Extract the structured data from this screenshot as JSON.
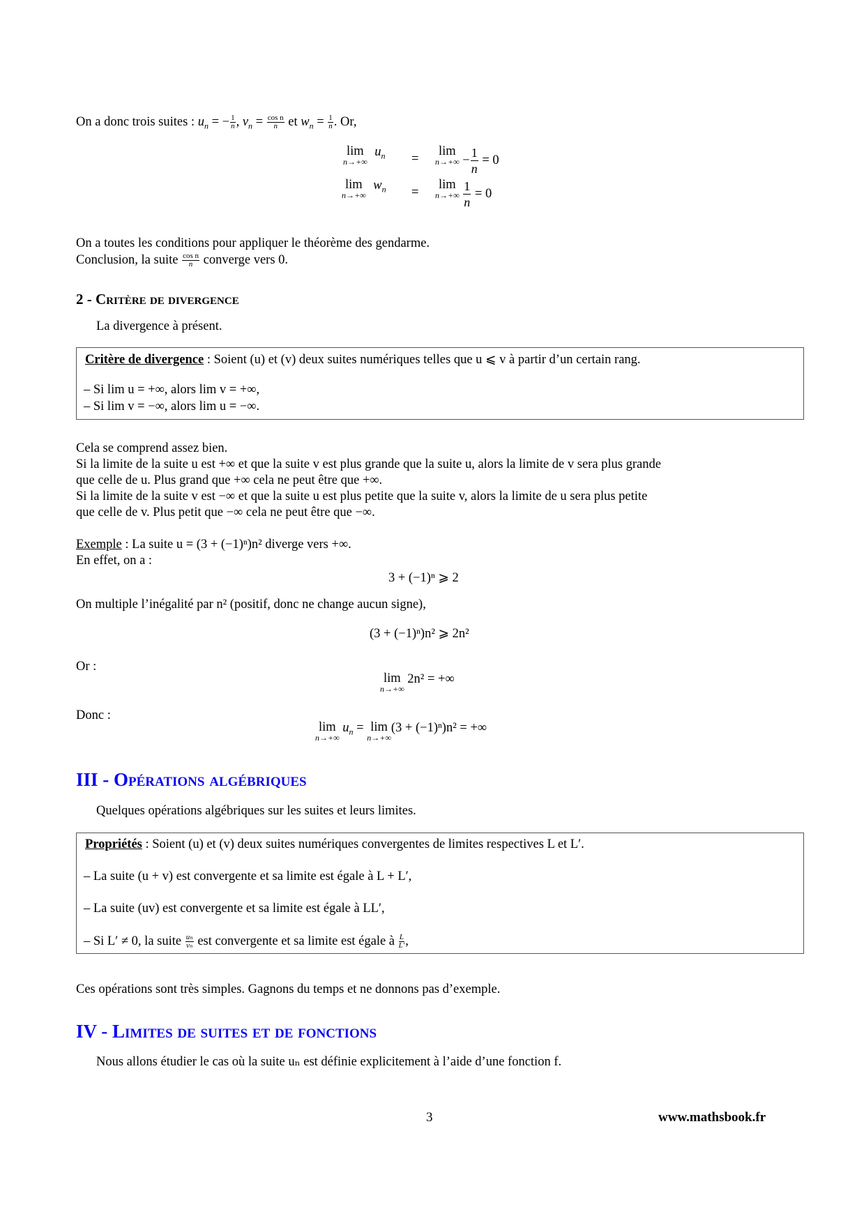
{
  "intro": {
    "line1_prefix": "On a donc trois suites : ",
    "u_def": "u",
    "u_value_text": "= −",
    "v_label": "v",
    "w_label": "w",
    "frac_1": "1",
    "frac_n": "n",
    "frac_cos": "cos n",
    "et": "et",
    "or": ". Or,"
  },
  "limits_block": {
    "row1": {
      "lhs": "lim",
      "under": "n→+∞",
      "var": "u",
      "eq": "=",
      "rhs_prefix": "−",
      "num": "1",
      "den": "n",
      "result": "= 0"
    },
    "row2": {
      "lhs": "lim",
      "under": "n→+∞",
      "var": "w",
      "eq": "=",
      "rhs_prefix": "",
      "num": "1",
      "den": "n",
      "result": "= 0"
    }
  },
  "conclusion": {
    "line1": "On a toutes les conditions pour appliquer le théorème des gendarme.",
    "line2_prefix": "Conclusion, la suite ",
    "line2_suffix": " converge vers 0."
  },
  "section2": {
    "number": "2 - ",
    "title": "Critère de divergence",
    "intro": "La divergence à présent."
  },
  "divergence_box": {
    "label": "Critère de divergence",
    "statement": " : Soient (u) et (v) deux suites numériques telles que u ⩽ v à partir d’un certain rang.",
    "item1": "– Si lim u = +∞, alors lim v = +∞,",
    "item2": "– Si lim v = −∞, alors lim u = −∞."
  },
  "explanation": {
    "l1": "Cela se comprend assez bien.",
    "l2": "Si la limite de la suite u est +∞ et que la suite v est plus grande que la suite u, alors la limite de v sera plus grande",
    "l3": "que celle de u. Plus grand que +∞ cela ne peut être que +∞.",
    "l4": "Si la limite de la suite v est −∞ et que la suite u est plus petite que la suite v, alors la limite de u sera plus petite",
    "l5": "que celle de v. Plus petit que −∞ cela ne peut être que −∞."
  },
  "example": {
    "label": "Exemple",
    "text": " : La suite u = (3 + (−1)ⁿ)n² diverge vers +∞.",
    "en_effet": "En effet, on a :",
    "ineq1": "3 + (−1)ⁿ ⩾ 2",
    "multiply": "On multiple l’inégalité par n² (positif, donc ne change aucun signe),",
    "ineq2": "(3 + (−1)ⁿ)n² ⩾ 2n²",
    "or": "Or :",
    "lim1_expr": "2n² = +∞",
    "donc": "Donc :",
    "lim2_a": "u",
    "lim2_b": "= ",
    "lim2_c": "(3 + (−1)ⁿ)n² = +∞",
    "lim_word": "lim",
    "lim_under": "n→+∞"
  },
  "section3": {
    "number": "III - ",
    "title": "Opérations algébriques",
    "intro": "Quelques opérations algébriques sur les suites et leurs limites."
  },
  "properties_box": {
    "label": "Propriétés",
    "statement": " : Soient (u) et (v) deux suites numériques convergentes de limites respectives L et L′.",
    "item1": "– La suite (u + v) est convergente et sa limite est égale à L + L′,",
    "item2": "– La suite (uv) est convergente et sa limite est égale à LL′,",
    "item3_a": "– Si L′ ≠ 0, la suite ",
    "item3_b": " est convergente et sa limite est égale à ",
    "item3_c": ",",
    "frac_un": "uₙ",
    "frac_vn": "vₙ",
    "frac_L": "L",
    "frac_Lp": "L′"
  },
  "after_props": "Ces opérations sont très simples. Gagnons du temps et ne donnons pas d’exemple.",
  "section4": {
    "number": "IV - ",
    "title": "Limites de suites et de fonctions",
    "intro": "Nous allons étudier le cas où la suite uₙ est définie explicitement à l’aide d’une fonction f."
  },
  "footer": {
    "page": "3",
    "site": "www.mathsbook.fr"
  },
  "colors": {
    "heading_blue": "#0a0af0"
  }
}
